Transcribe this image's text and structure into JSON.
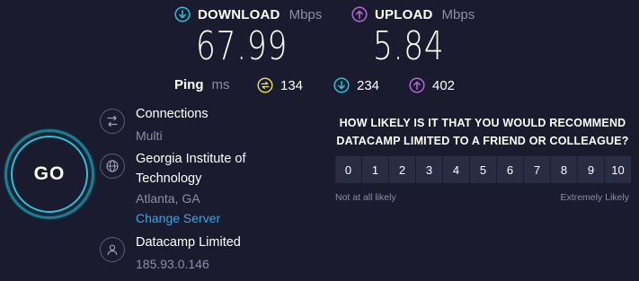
{
  "download": {
    "label": "DOWNLOAD",
    "unit": "Mbps",
    "value": "67.99",
    "icon": "download-arrow-icon",
    "color": "#2bc3d8"
  },
  "upload": {
    "label": "UPLOAD",
    "unit": "Mbps",
    "value": "5.84",
    "icon": "upload-arrow-icon",
    "color": "#b46ad8"
  },
  "ping": {
    "label": "Ping",
    "unit": "ms",
    "idle": {
      "value": "134",
      "icon": "idle-latency-icon",
      "color": "#e3d96a"
    },
    "down": {
      "value": "234",
      "icon": "download-latency-icon",
      "color": "#2bc3d8"
    },
    "up": {
      "value": "402",
      "icon": "upload-latency-icon",
      "color": "#b46ad8"
    }
  },
  "go_button": {
    "label": "GO"
  },
  "connections": {
    "title": "Connections",
    "value": "Multi",
    "icon": "connections-arrows-icon"
  },
  "server": {
    "title_line1": "Georgia Institute of",
    "title_line2": "Technology",
    "location": "Atlanta, GA",
    "change_label": "Change Server",
    "icon": "globe-icon"
  },
  "provider": {
    "name": "Datacamp Limited",
    "ip": "185.93.0.146",
    "icon": "user-icon"
  },
  "survey": {
    "question_line1": "HOW LIKELY IS IT THAT YOU WOULD RECOMMEND",
    "question_line2": "DATACAMP LIMITED TO A FRIEND OR COLLEAGUE?",
    "scale": [
      "0",
      "1",
      "2",
      "3",
      "4",
      "5",
      "6",
      "7",
      "8",
      "9",
      "10"
    ],
    "low_label": "Not at all likely",
    "high_label": "Extremely Likely"
  }
}
